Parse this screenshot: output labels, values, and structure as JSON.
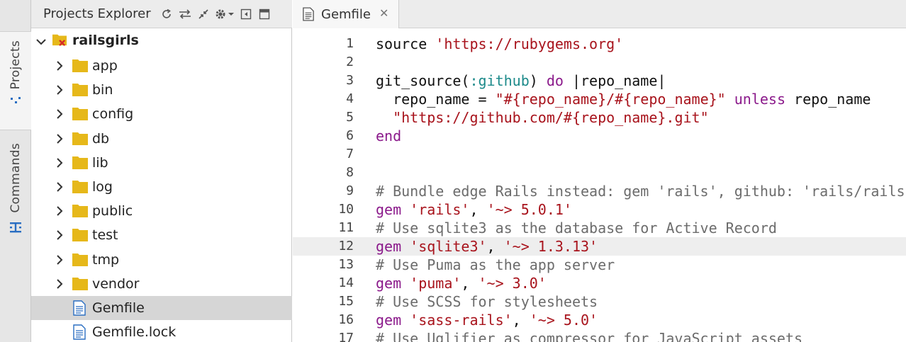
{
  "vertical_tabs": [
    {
      "id": "projects",
      "label": "Projects",
      "icon": "project-tree-icon"
    },
    {
      "id": "commands",
      "label": "Commands",
      "icon": "commands-icon"
    }
  ],
  "explorer": {
    "title": "Projects Explorer",
    "header_icons": [
      "refresh-icon",
      "sync-icon",
      "collapse-icon",
      "settings-icon",
      "minimize-panel-icon",
      "maximize-panel-icon"
    ]
  },
  "tree": [
    {
      "label": "railsgirls",
      "type": "project",
      "expanded": true
    },
    {
      "label": "app",
      "type": "folder"
    },
    {
      "label": "bin",
      "type": "folder"
    },
    {
      "label": "config",
      "type": "folder"
    },
    {
      "label": "db",
      "type": "folder"
    },
    {
      "label": "lib",
      "type": "folder"
    },
    {
      "label": "log",
      "type": "folder"
    },
    {
      "label": "public",
      "type": "folder"
    },
    {
      "label": "test",
      "type": "folder"
    },
    {
      "label": "tmp",
      "type": "folder"
    },
    {
      "label": "vendor",
      "type": "folder"
    },
    {
      "label": "Gemfile",
      "type": "file",
      "selected": true
    },
    {
      "label": "Gemfile.lock",
      "type": "file"
    }
  ],
  "editor": {
    "tab_label": "Gemfile",
    "close_glyph": "✕",
    "highlight_line": 12,
    "lines": [
      [
        [
          "t-plain",
          "source "
        ],
        [
          "t-str",
          "'https://rubygems.org'"
        ]
      ],
      [],
      [
        [
          "t-plain",
          "git_source("
        ],
        [
          "t-sym",
          ":github"
        ],
        [
          "t-plain",
          ") "
        ],
        [
          "t-kw",
          "do"
        ],
        [
          "t-plain",
          " |repo_name|"
        ]
      ],
      [
        [
          "t-plain",
          "  repo_name = "
        ],
        [
          "t-str",
          "\"#{repo_name}/#{repo_name}\""
        ],
        [
          "t-plain",
          " "
        ],
        [
          "t-kw",
          "unless"
        ],
        [
          "t-plain",
          " repo_name"
        ]
      ],
      [
        [
          "t-plain",
          "  "
        ],
        [
          "t-str",
          "\"https://github.com/#{repo_name}.git\""
        ]
      ],
      [
        [
          "t-kw",
          "end"
        ]
      ],
      [],
      [],
      [
        [
          "t-com",
          "# Bundle edge Rails instead: gem 'rails', github: 'rails/rails'"
        ]
      ],
      [
        [
          "t-kw",
          "gem"
        ],
        [
          "t-plain",
          " "
        ],
        [
          "t-str",
          "'rails'"
        ],
        [
          "t-plain",
          ", "
        ],
        [
          "t-str",
          "'~> 5.0.1'"
        ]
      ],
      [
        [
          "t-com",
          "# Use sqlite3 as the database for Active Record"
        ]
      ],
      [
        [
          "t-kw",
          "gem"
        ],
        [
          "t-plain",
          " "
        ],
        [
          "t-str",
          "'sqlite3'"
        ],
        [
          "t-plain",
          ", "
        ],
        [
          "t-str",
          "'~> 1.3.13'"
        ]
      ],
      [
        [
          "t-com",
          "# Use Puma as the app server"
        ]
      ],
      [
        [
          "t-kw",
          "gem"
        ],
        [
          "t-plain",
          " "
        ],
        [
          "t-str",
          "'puma'"
        ],
        [
          "t-plain",
          ", "
        ],
        [
          "t-str",
          "'~> 3.0'"
        ]
      ],
      [
        [
          "t-com",
          "# Use SCSS for stylesheets"
        ]
      ],
      [
        [
          "t-kw",
          "gem"
        ],
        [
          "t-plain",
          " "
        ],
        [
          "t-str",
          "'sass-rails'"
        ],
        [
          "t-plain",
          ", "
        ],
        [
          "t-str",
          "'~> 5.0'"
        ]
      ],
      [
        [
          "t-com",
          "# Use Uglifier as compressor for JavaScript assets"
        ]
      ]
    ]
  },
  "colors": {
    "string": "#a8131c",
    "keyword": "#8b1a8b",
    "symbol": "#1c8a8a",
    "comment": "#6c6c6c",
    "folder": "#e6b81a",
    "accent": "#2a6ec2"
  }
}
